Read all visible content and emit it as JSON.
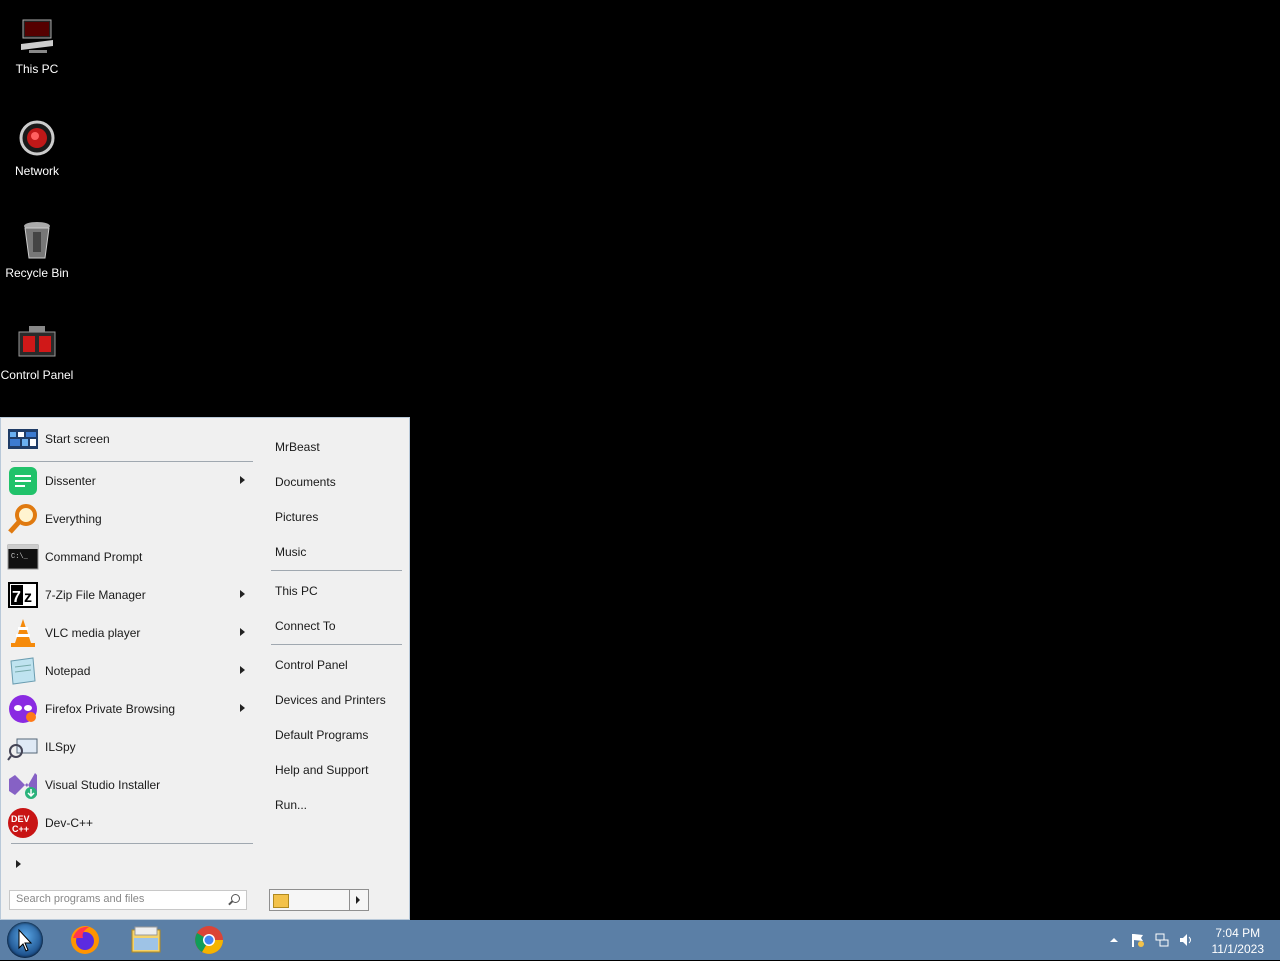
{
  "desktop": {
    "icons": [
      {
        "label": "This PC"
      },
      {
        "label": "Network"
      },
      {
        "label": "Recycle Bin"
      },
      {
        "label": "Control Panel"
      }
    ]
  },
  "start_menu": {
    "pinned": {
      "label": "Start screen"
    },
    "programs": [
      {
        "label": "Dissenter",
        "submenu": true
      },
      {
        "label": "Everything",
        "submenu": false
      },
      {
        "label": "Command Prompt",
        "submenu": false
      },
      {
        "label": "7-Zip File Manager",
        "submenu": true
      },
      {
        "label": "VLC media player",
        "submenu": true
      },
      {
        "label": "Notepad",
        "submenu": true
      },
      {
        "label": "Firefox Private Browsing",
        "submenu": true
      },
      {
        "label": "ILSpy",
        "submenu": false
      },
      {
        "label": "Visual Studio Installer",
        "submenu": false
      },
      {
        "label": "Dev-C++",
        "submenu": false
      }
    ],
    "places": [
      "MrBeast",
      "Documents",
      "Pictures",
      "Music",
      "This PC",
      "Connect To",
      "Control Panel",
      "Devices and Printers",
      "Default Programs",
      "Help and Support",
      "Run..."
    ],
    "search_placeholder": "Search programs and files"
  },
  "taskbar": {
    "clock_time": "7:04 PM",
    "clock_date": "11/1/2023"
  }
}
